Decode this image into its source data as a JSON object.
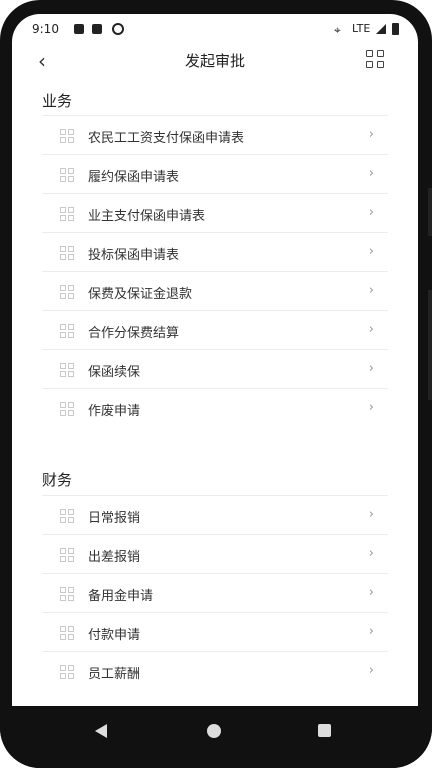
{
  "statusbar": {
    "time": "9:10",
    "network": "LTE"
  },
  "header": {
    "title": "发起审批"
  },
  "sections": [
    {
      "title": "业务",
      "items": [
        {
          "label": "农民工工资支付保函申请表"
        },
        {
          "label": "履约保函申请表"
        },
        {
          "label": "业主支付保函申请表"
        },
        {
          "label": "投标保函申请表"
        },
        {
          "label": "保费及保证金退款"
        },
        {
          "label": "合作分保费结算"
        },
        {
          "label": "保函续保"
        },
        {
          "label": "作废申请"
        }
      ]
    },
    {
      "title": "财务",
      "items": [
        {
          "label": "日常报销"
        },
        {
          "label": "出差报销"
        },
        {
          "label": "备用金申请"
        },
        {
          "label": "付款申请"
        },
        {
          "label": "员工薪酬"
        }
      ]
    }
  ],
  "icons": {
    "back": "chevron-left-icon",
    "apps": "grid-icon",
    "item": "grid-icon",
    "chevron": "chevron-right-icon"
  }
}
